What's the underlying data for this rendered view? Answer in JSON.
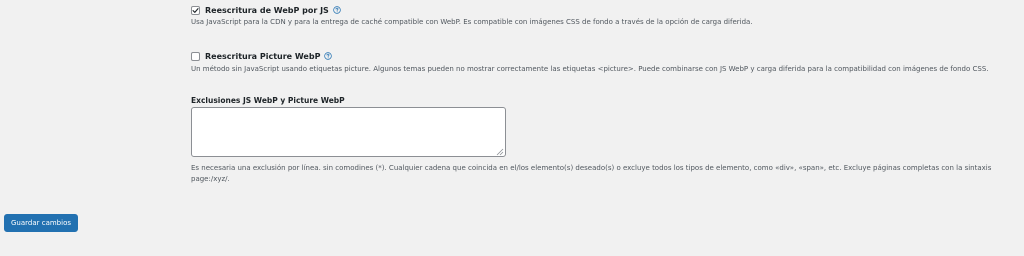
{
  "options": [
    {
      "label": "Reescritura de WebP por JS",
      "checked": true,
      "description": "Usa JavaScript para la CDN y para la entrega de caché compatible con WebP. Es compatible con imágenes CSS de fondo a través de la opción de carga diferida."
    },
    {
      "label": "Reescritura Picture WebP",
      "checked": false,
      "description": "Un método sin JavaScript usando etiquetas picture. Algunos temas pueden no mostrar correctamente las etiquetas <picture>. Puede combinarse con JS WebP y carga diferida para la compatibilidad con imágenes de fondo CSS."
    }
  ],
  "exclusions": {
    "label": "Exclusiones JS WebP y Picture WebP",
    "value": "",
    "note": "Es necesaria una exclusión por línea. sin comodines (*). Cualquier cadena que coincida en el/los elemento(s) deseado(s) o excluye todos los tipos de elemento, como «div», «span», etc. Excluye páginas completas con la sintaxis page:/xyz/."
  },
  "save_button": {
    "label": "Guardar cambios"
  },
  "colors": {
    "accent": "#2271b1",
    "background": "#f1f1f1",
    "help_icon": "#2271b1"
  },
  "icons": {
    "check": "checkmark-icon",
    "help": "help-circle-icon",
    "resize": "resize-grip-icon"
  }
}
